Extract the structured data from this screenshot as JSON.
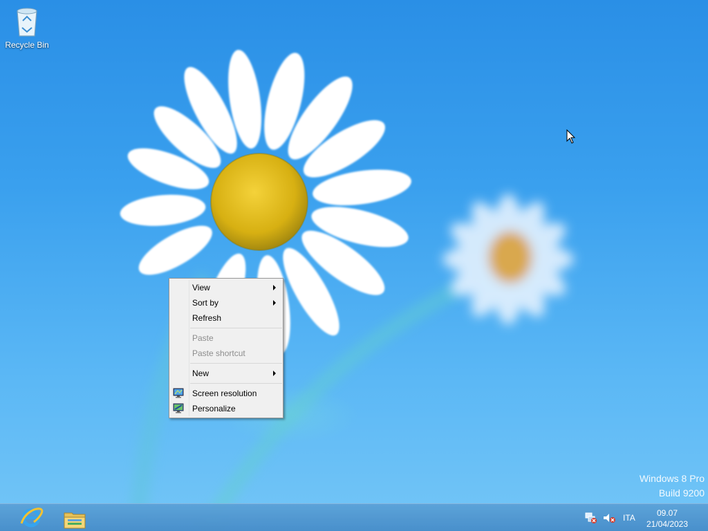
{
  "desktop": {
    "icons": [
      {
        "label": "Recycle Bin",
        "icon": "recycle-bin-icon"
      }
    ],
    "watermark": {
      "line1": "Windows 8 Pro",
      "line2": "Build 9200"
    }
  },
  "context_menu": {
    "items": [
      {
        "label": "View",
        "submenu": true,
        "enabled": true
      },
      {
        "label": "Sort by",
        "submenu": true,
        "enabled": true
      },
      {
        "label": "Refresh",
        "submenu": false,
        "enabled": true
      },
      {
        "label": "Paste",
        "submenu": false,
        "enabled": false
      },
      {
        "label": "Paste shortcut",
        "submenu": false,
        "enabled": false
      },
      {
        "label": "New",
        "submenu": true,
        "enabled": true
      },
      {
        "label": "Screen resolution",
        "submenu": false,
        "enabled": true,
        "icon": "screen-resolution-icon"
      },
      {
        "label": "Personalize",
        "submenu": false,
        "enabled": true,
        "icon": "personalize-icon"
      }
    ]
  },
  "taskbar": {
    "pinned": [
      {
        "name": "internet-explorer",
        "icon": "internet-explorer-icon"
      },
      {
        "name": "file-explorer",
        "icon": "file-explorer-icon"
      }
    ],
    "tray": {
      "network_icon": "network-disconnected-icon",
      "volume_icon": "volume-muted-icon",
      "language": "ITA",
      "time": "09.07",
      "date": "21/04/2023"
    }
  },
  "colors": {
    "wallpaper_top": "#2a8fe6",
    "wallpaper_bottom": "#74c6f7",
    "menu_bg": "#f0f0f0",
    "disabled_text": "#8d8d8d"
  }
}
